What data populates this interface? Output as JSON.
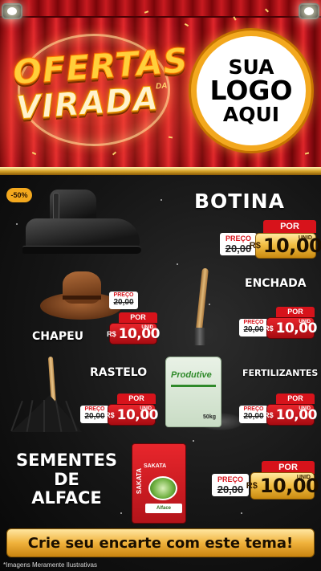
{
  "header": {
    "title_line1": "OFERTAS",
    "title_line2": "VIRADA",
    "title_suffix": "DA",
    "logo_line1": "SUA",
    "logo_line2": "LOGO",
    "logo_line3": "AQUI"
  },
  "colors": {
    "gold": "#f3a81e",
    "red": "#d7131b",
    "curtain": "#b3151a",
    "background": "#151515"
  },
  "discount_badge": "-50%",
  "products": {
    "botina": {
      "name": "BOTINA",
      "preco_label": "PREÇO",
      "preco_old": "20,00",
      "por_label": "POR",
      "currency": "R$",
      "price": "10,00",
      "unit": "UNID"
    },
    "enchada": {
      "name": "ENCHADA",
      "preco_label": "PREÇO",
      "preco_old": "20,00",
      "por_label": "POR",
      "currency": "R$",
      "price": "10,00",
      "unit": "UNID"
    },
    "chapeu": {
      "name": "CHAPEU",
      "preco_label": "PREÇO",
      "preco_old": "20,00",
      "por_label": "POR",
      "currency": "R$",
      "price": "10,00",
      "unit": "UNID"
    },
    "rastelo": {
      "name": "RASTELO",
      "preco_label": "PREÇO",
      "preco_old": "20,00",
      "por_label": "POR",
      "currency": "R$",
      "price": "10,00",
      "unit": "UNID"
    },
    "fertilizantes": {
      "name": "FERTILIZANTES",
      "preco_label": "PREÇO",
      "preco_old": "20,00",
      "por_label": "POR",
      "currency": "R$",
      "price": "10,00",
      "unit": "UNID",
      "bag_brand": "Produtive",
      "bag_weight": "50kg"
    },
    "sementes": {
      "name_line1": "SEMENTES",
      "name_line2": "DE",
      "name_line3": "ALFACE",
      "preco_label": "PREÇO",
      "preco_old": "20,00",
      "por_label": "POR",
      "currency": "R$",
      "price": "10,00",
      "unit": "UNID",
      "pack_brand": "SAKATA",
      "pack_label": "Alface"
    }
  },
  "icons": {
    "boot": "boot-image",
    "hat": "hat-image",
    "hoe": "hoe-image",
    "rake": "rake-image",
    "fertilizer": "fertilizer-bag-image",
    "seeds": "seed-packet-image",
    "spotlight": "spotlight-icon"
  },
  "footer": {
    "cta": "Crie seu encarte com este tema!",
    "disclaimer": "*Imagens Meramente Ilustrativas"
  }
}
